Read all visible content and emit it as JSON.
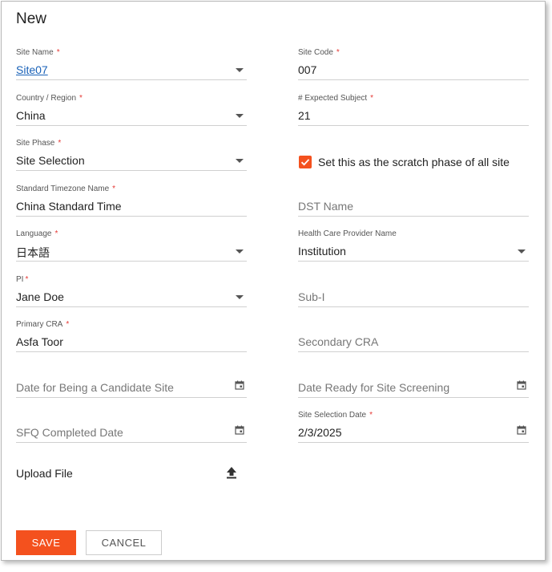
{
  "dialog": {
    "title": "New"
  },
  "left": {
    "site_name": {
      "label": "Site Name",
      "required": "*",
      "value": "Site07"
    },
    "country": {
      "label": "Country / Region",
      "required": "*",
      "value": "China"
    },
    "site_phase": {
      "label": "Site Phase",
      "required": "*",
      "value": "Site Selection"
    },
    "timezone": {
      "label": "Standard Timezone Name",
      "required": "*",
      "value": "China Standard Time"
    },
    "language": {
      "label": "Language",
      "required": "*",
      "value": "日本語"
    },
    "pi": {
      "label": "PI",
      "required": "*",
      "value": "Jane Doe"
    },
    "primary_cra": {
      "label": "Primary CRA",
      "required": "*",
      "value": "Asfa Toor"
    },
    "candidate_date": {
      "placeholder": "Date for Being a Candidate Site"
    },
    "sfq_date": {
      "placeholder": "SFQ Completed Date"
    },
    "upload": {
      "label": "Upload File"
    }
  },
  "right": {
    "site_code": {
      "label": "Site Code",
      "required": "*",
      "value": "007"
    },
    "expected_subject": {
      "label": "# Expected Subject",
      "required": "*",
      "value": "21"
    },
    "scratch_phase": {
      "label": "Set this as the scratch phase of all site",
      "checked": true
    },
    "dst_name": {
      "placeholder": "DST Name"
    },
    "hcp_name": {
      "label": "Health Care Provider Name",
      "value": "Institution"
    },
    "sub_i": {
      "placeholder": "Sub-I"
    },
    "secondary_cra": {
      "placeholder": "Secondary CRA"
    },
    "screening_date": {
      "placeholder": "Date Ready for Site Screening"
    },
    "selection_date": {
      "label": "Site Selection Date",
      "required": "*",
      "value": "2/3/2025"
    }
  },
  "actions": {
    "save": "SAVE",
    "cancel": "CANCEL"
  },
  "colors": {
    "accent": "#f4511e",
    "link": "#1a62b8",
    "required": "#e53935"
  },
  "icons": {
    "dropdown": "chevron-down-icon",
    "calendar": "calendar-icon",
    "upload": "upload-icon",
    "check": "check-icon"
  }
}
